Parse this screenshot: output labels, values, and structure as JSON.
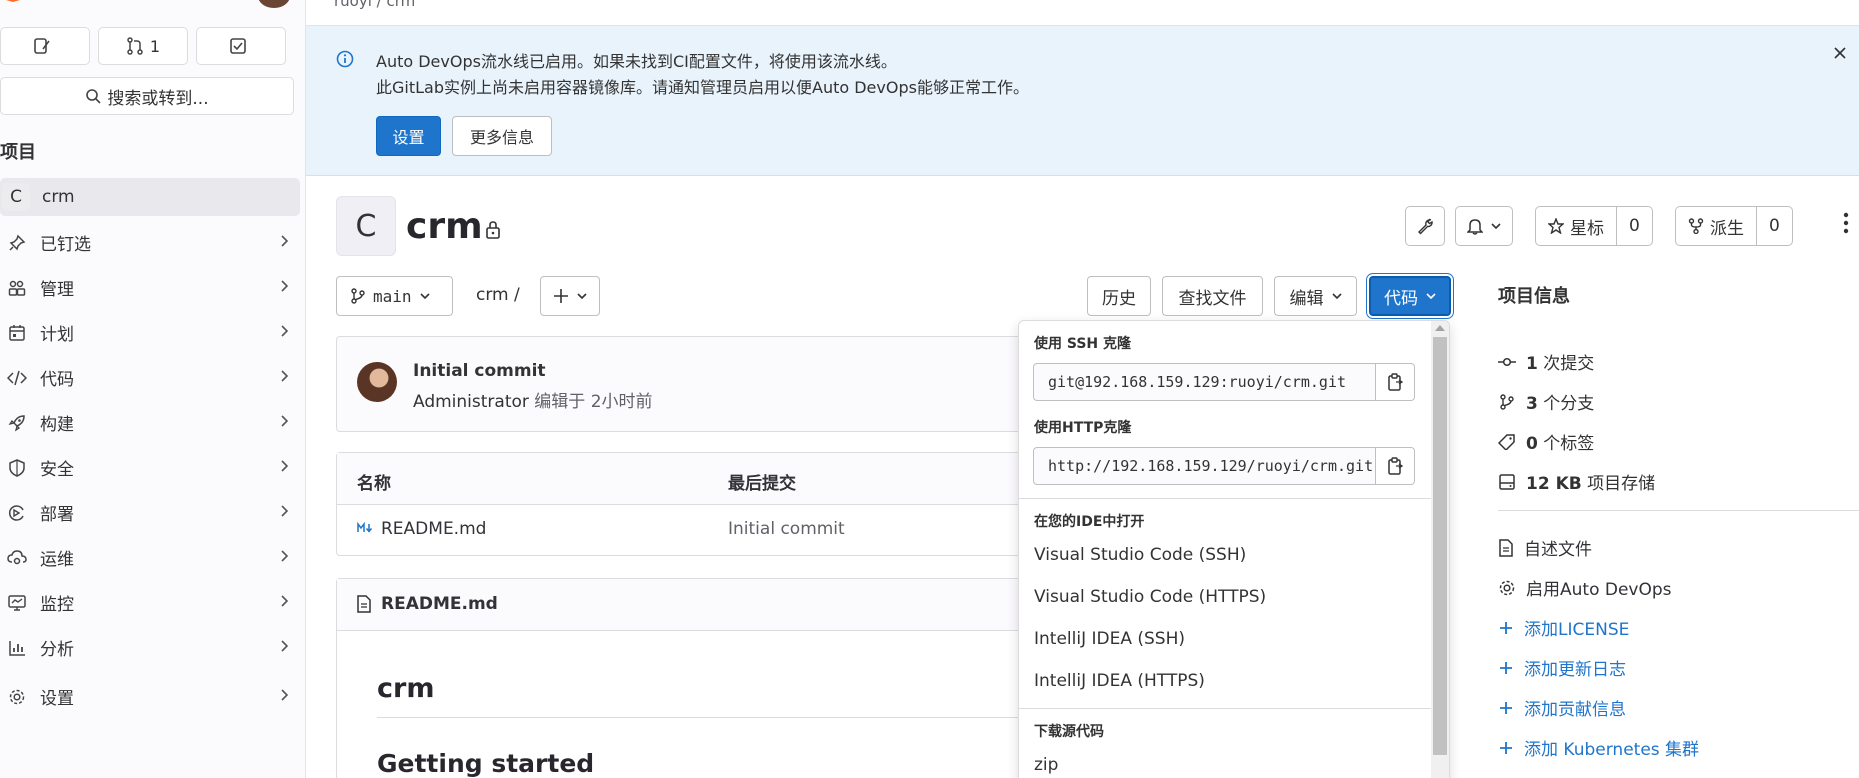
{
  "sidebar": {
    "counters": [
      {
        "label": ""
      },
      {
        "label": "1"
      },
      {
        "label": ""
      }
    ],
    "search_label": "搜索或转到...",
    "section_title": "项目",
    "active_project": {
      "initial": "C",
      "name": "crm"
    },
    "items": [
      {
        "label": "已钉选",
        "icon": "pin-icon"
      },
      {
        "label": "管理",
        "icon": "users-icon"
      },
      {
        "label": "计划",
        "icon": "calendar-icon"
      },
      {
        "label": "代码",
        "icon": "code-icon"
      },
      {
        "label": "构建",
        "icon": "rocket-icon"
      },
      {
        "label": "安全",
        "icon": "shield-icon"
      },
      {
        "label": "部署",
        "icon": "deploy-icon"
      },
      {
        "label": "运维",
        "icon": "cloud-gear-icon"
      },
      {
        "label": "监控",
        "icon": "monitor-icon"
      },
      {
        "label": "分析",
        "icon": "chart-icon"
      },
      {
        "label": "设置",
        "icon": "gear-icon"
      }
    ]
  },
  "breadcrumb": "ruoyi / crm",
  "banner": {
    "line1": "Auto DevOps流水线已启用。如果未找到CI配置文件，将使用该流水线。",
    "line2": "此GitLab实例上尚未启用容器镜像库。请通知管理员启用以便Auto DevOps能够正常工作。",
    "primary_button": "设置",
    "secondary_button": "更多信息"
  },
  "project": {
    "initial": "C",
    "name": "crm",
    "star_label": "星标",
    "star_count": "0",
    "fork_label": "派生",
    "fork_count": "0"
  },
  "repo_toolbar": {
    "branch": "main",
    "path": "crm /",
    "history": "历史",
    "find_file": "查找文件",
    "edit": "编辑",
    "code": "代码"
  },
  "last_commit": {
    "title": "Initial commit",
    "author": "Administrator",
    "meta": "编辑于 2小时前"
  },
  "file_table": {
    "col_name": "名称",
    "col_last_commit": "最后提交",
    "rows": [
      {
        "name": "README.md",
        "commit": "Initial commit"
      }
    ]
  },
  "readme": {
    "file": "README.md",
    "h1": "crm",
    "h2": "Getting started"
  },
  "project_info": {
    "title": "项目信息",
    "stats": [
      {
        "value": "1",
        "label": "次提交",
        "icon": "commit-icon"
      },
      {
        "value": "3",
        "label": "个分支",
        "icon": "branch-icon"
      },
      {
        "value": "0",
        "label": "个标签",
        "icon": "tag-icon"
      },
      {
        "value": "12 KB",
        "label": "项目存储",
        "icon": "storage-icon"
      }
    ],
    "links": [
      {
        "label": "自述文件",
        "icon": "file-icon"
      },
      {
        "label": "启用Auto DevOps",
        "icon": "gear-icon"
      },
      {
        "label": "添加LICENSE",
        "icon": "plus-icon"
      },
      {
        "label": "添加更新日志",
        "icon": "plus-icon"
      },
      {
        "label": "添加贡献信息",
        "icon": "plus-icon"
      },
      {
        "label": "添加 Kubernetes 集群",
        "icon": "plus-icon"
      }
    ]
  },
  "clone_dropdown": {
    "ssh_title": "使用 SSH 克隆",
    "ssh_url": "git@192.168.159.129:ruoyi/crm.git",
    "http_title": "使用HTTP克隆",
    "http_url": "http://192.168.159.129/ruoyi/crm.git",
    "ide_title": "在您的IDE中打开",
    "ide_items": [
      "Visual Studio Code (SSH)",
      "Visual Studio Code (HTTPS)",
      "IntelliJ IDEA (SSH)",
      "IntelliJ IDEA (HTTPS)"
    ],
    "download_title": "下载源代码",
    "download_items": [
      "zip"
    ]
  },
  "colors": {
    "accent": "#1f75cb",
    "banner_bg": "#e9f3fc"
  }
}
